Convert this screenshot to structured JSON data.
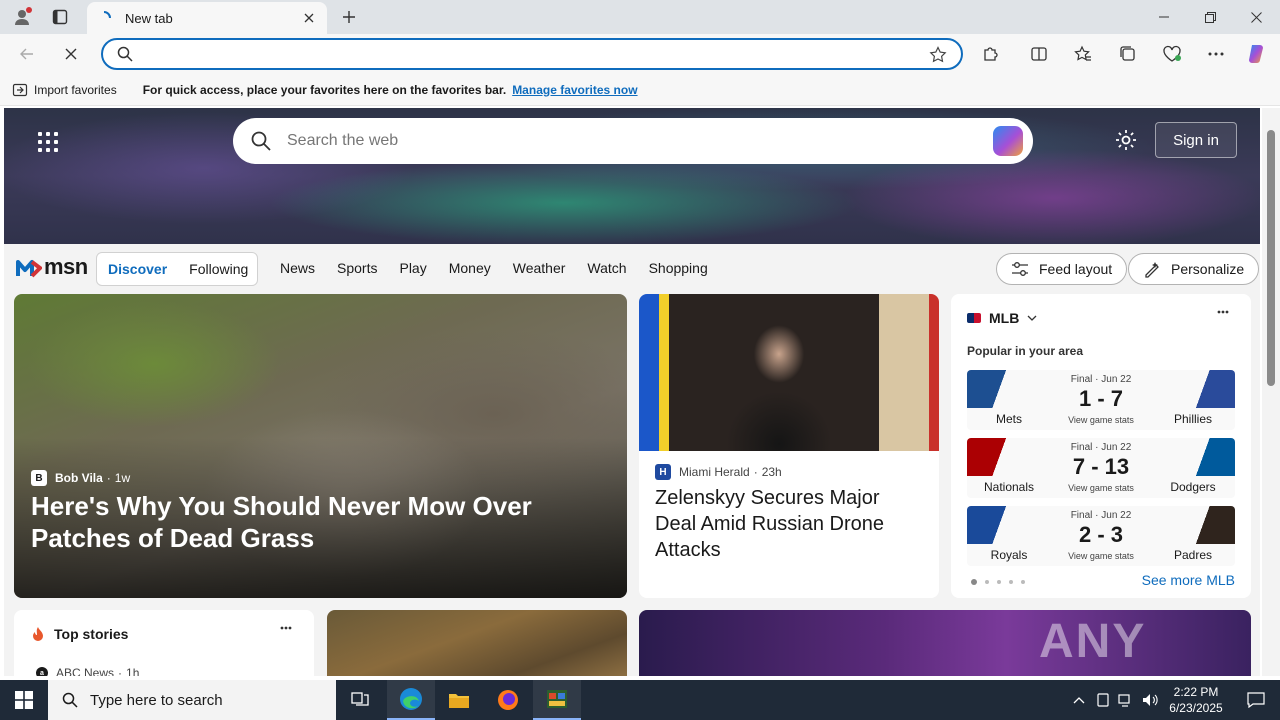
{
  "browser": {
    "tab_title": "New tab",
    "address_value": "",
    "favorites_bar": {
      "import_label": "Import favorites",
      "message": "For quick access, place your favorites here on the favorites bar.",
      "manage_link": "Manage favorites now"
    }
  },
  "msn": {
    "search_placeholder": "Search the web",
    "sign_in": "Sign in",
    "logo_text": "msn",
    "segments": [
      "Discover",
      "Following"
    ],
    "nav_links": [
      "News",
      "Sports",
      "Play",
      "Money",
      "Weather",
      "Watch",
      "Shopping"
    ],
    "feed_layout": "Feed layout",
    "personalize": "Personalize",
    "main_story": {
      "source": "Bob Vila",
      "age": "1w",
      "headline": "Here's Why You Should Never Mow Over Patches of Dead Grass"
    },
    "side_story": {
      "source": "Miami Herald",
      "age": "23h",
      "headline": "Zelenskyy Secures Major Deal Amid Russian Drone Attacks"
    },
    "mlb": {
      "title": "MLB",
      "subtitle": "Popular in your area",
      "see_more": "See more MLB",
      "view_stats": "View game stats",
      "games": [
        {
          "status": "Final · Jun 22",
          "home": "Mets",
          "away": "Phillies",
          "score": "1 - 7",
          "home_color": "#1d4f91",
          "away_color": "#2a4b9b"
        },
        {
          "status": "Final · Jun 22",
          "home": "Nationals",
          "away": "Dodgers",
          "score": "7 - 13",
          "home_color": "#ab0003",
          "away_color": "#005a9c"
        },
        {
          "status": "Final · Jun 22",
          "home": "Royals",
          "away": "Padres",
          "score": "2 - 3",
          "home_color": "#1a4a9a",
          "away_color": "#2f241d"
        }
      ]
    },
    "top_stories": {
      "title": "Top stories",
      "source": "ABC News",
      "age": "1h"
    },
    "watermark": "ANY RUN"
  },
  "taskbar": {
    "search_placeholder": "Type here to search",
    "time": "2:22 PM",
    "date": "6/23/2025"
  }
}
